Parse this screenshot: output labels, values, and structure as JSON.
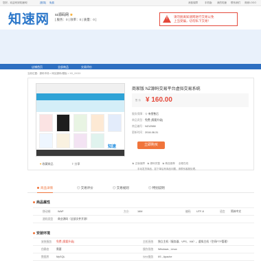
{
  "topbar": {
    "greeting": "您好，欢迎来到知速网！",
    "login": "[登录]",
    "register": "免费",
    "right": [
      "消费保障",
      "手机版",
      "我的知速",
      "联系我们",
      "商家LOGO"
    ]
  },
  "header": {
    "logo": "知速网",
    "shop_name": "sz源码网",
    "scores": "[ 服务：0 | 效率：0 | 质量：0 ]"
  },
  "notice": {
    "line1": "请勿脱离知速网进行交易以免",
    "line2": "上当受骗，切勿私下交易！"
  },
  "nav": {
    "items": [
      "店铺首页",
      "全部商品",
      "交易评价"
    ]
  },
  "breadcrumb": "当前位置：源码市场 > 网站源码/模板 > XX_XXXX",
  "product": {
    "title": "商家版 NZ源码交易平台虚拟交易系统",
    "price_label": "售 价",
    "price": "¥ 160.00",
    "rows": [
      {
        "label": "服务保障：",
        "value": "☆ 有偿售后"
      },
      {
        "label": "商品类型：",
        "value": "免费",
        "extra": "[需要升级]"
      },
      {
        "label": "商品编号：",
        "value": "NZ12588"
      },
      {
        "label": "更新时间：",
        "value": "2018-08-31"
      }
    ],
    "buy_label": "立即购买",
    "fav_label": "收藏商品",
    "share_label": "分享",
    "tags": [
      "★ 正版保障",
      "★ 源码完整",
      "★ 精品推荐",
      "全程在线"
    ],
    "desc": "手动发货商品，如下单后有商品问题，请联系客服处理。"
  },
  "tabs": [
    "商品详情",
    "交易评价",
    "交易规则",
    "特别说明"
  ],
  "info_section": {
    "title": "商品属性",
    "rows": [
      [
        {
          "k": "移动端",
          "v": "WAP"
        },
        {
          "k": "大小",
          "v": "16M"
        },
        {
          "k": "编码",
          "v": "UTF-8"
        },
        {
          "k": "语言",
          "v": "简体中文"
        }
      ],
      [
        {
          "k": "源码类型",
          "v": "商业源码（全部文件开源）"
        },
        {
          "k": "",
          "v": ""
        },
        {
          "k": "",
          "v": ""
        },
        {
          "k": "",
          "v": ""
        }
      ]
    ]
  },
  "env_section": {
    "title": "安装环境",
    "rows": [
      [
        {
          "k": "安装服务",
          "v": "免费 [需要升级]"
        },
        {
          "k": "主机系统",
          "v": "独立主机（服务器、VPS、VM），虚拟主机（空间FTP管理）"
        }
      ],
      [
        {
          "k": "伪静态",
          "v": "需要"
        },
        {
          "k": "操作系统",
          "v": "Windows , Linux"
        }
      ],
      [
        {
          "k": "数据库",
          "v": "MySQL"
        },
        {
          "k": "Web服务",
          "v": "IIS , Apache"
        }
      ]
    ]
  },
  "colors": {
    "brand": "#2a76c9",
    "accent": "#f0743b",
    "price": "#e4483a",
    "nav": "#2d6fc1"
  }
}
